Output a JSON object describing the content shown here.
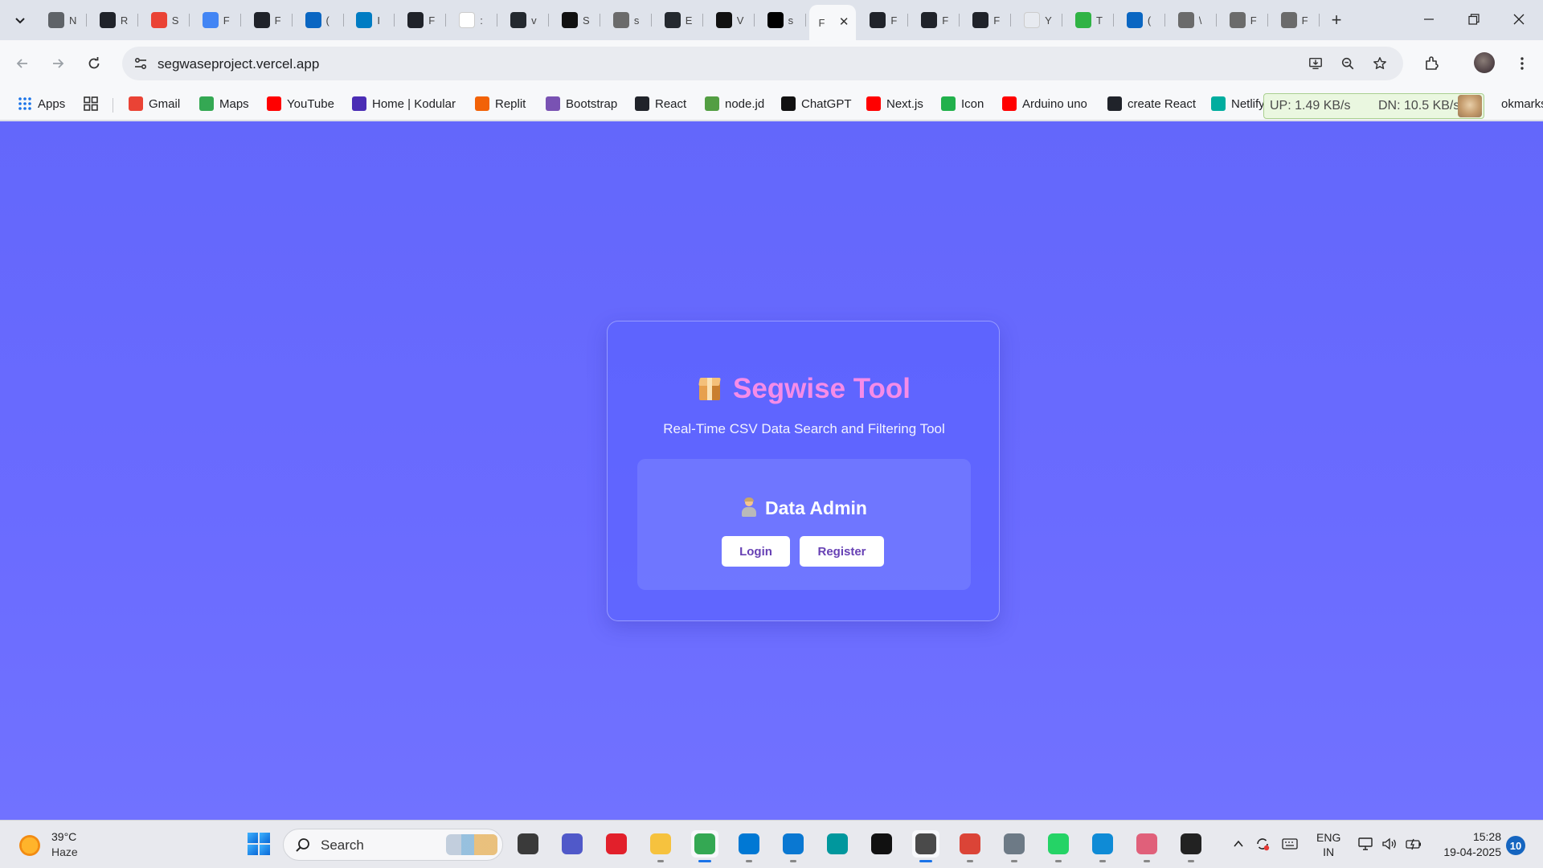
{
  "browser": {
    "tabs": [
      {
        "icon": "nf-icon",
        "letter": "N",
        "color": "#5f6368"
      },
      {
        "icon": "react-icon",
        "letter": "R",
        "color": "#20232a"
      },
      {
        "icon": "gmail-icon",
        "letter": "S",
        "color": "#ea4335"
      },
      {
        "icon": "docs-icon",
        "letter": "F",
        "color": "#4285f4"
      },
      {
        "icon": "react-icon",
        "letter": "F",
        "color": "#20232a"
      },
      {
        "icon": "linkedin-icon",
        "letter": "(",
        "color": "#0a66c2"
      },
      {
        "icon": "infosys-icon",
        "letter": "I",
        "color": "#007cc3"
      },
      {
        "icon": "react-icon",
        "letter": "F",
        "color": "#20232a"
      },
      {
        "icon": "google-icon",
        "letter": ":",
        "color": "#ffffff"
      },
      {
        "icon": "github-icon",
        "letter": "v",
        "color": "#24292f"
      },
      {
        "icon": "toolbox-icon",
        "letter": "S",
        "color": "#111111"
      },
      {
        "icon": "globe-icon",
        "letter": "s",
        "color": "#6b6b6b"
      },
      {
        "icon": "github-icon",
        "letter": "E",
        "color": "#24292f"
      },
      {
        "icon": "openai-icon",
        "letter": "V",
        "color": "#111111"
      },
      {
        "icon": "vercel-icon",
        "letter": "s",
        "color": "#000000"
      },
      {
        "icon": "page-icon",
        "letter": "F",
        "color": "#ffffff"
      },
      {
        "icon": "react-icon",
        "letter": "F",
        "color": "#20232a"
      },
      {
        "icon": "react-icon",
        "letter": "F",
        "color": "#20232a"
      },
      {
        "icon": "react-icon",
        "letter": "F",
        "color": "#20232a"
      },
      {
        "icon": "blob-icon",
        "letter": "Y",
        "color": "#e7eaf0"
      },
      {
        "icon": "s-icon",
        "letter": "T",
        "color": "#2fb344"
      },
      {
        "icon": "linkedin-icon",
        "letter": "(",
        "color": "#0a66c2"
      },
      {
        "icon": "globe-icon",
        "letter": "\\",
        "color": "#6b6b6b"
      },
      {
        "icon": "globe-icon",
        "letter": "F",
        "color": "#6b6b6b"
      },
      {
        "icon": "globe-icon",
        "letter": "F",
        "color": "#6b6b6b"
      }
    ],
    "active_tab_index": 15,
    "url": "segwaseproject.vercel.app"
  },
  "bookmarks": [
    {
      "label": "Apps",
      "icon": "apps-grid-icon",
      "color": "#1a73e8"
    },
    {
      "label": "Gmail",
      "icon": "gmail-icon",
      "color": "#ea4335"
    },
    {
      "label": "Maps",
      "icon": "maps-icon",
      "color": "#34a853"
    },
    {
      "label": "YouTube",
      "icon": "youtube-icon",
      "color": "#ff0000"
    },
    {
      "label": "Home | Kodular",
      "icon": "kodular-icon",
      "color": "#4b2db5"
    },
    {
      "label": "Replit",
      "icon": "replit-icon",
      "color": "#f26207"
    },
    {
      "label": "Bootstrap",
      "icon": "bootstrap-icon",
      "color": "#7952b3"
    },
    {
      "label": "React",
      "icon": "react-icon",
      "color": "#20232a"
    },
    {
      "label": "node.jd",
      "icon": "nodejs-icon",
      "color": "#539e43"
    },
    {
      "label": "ChatGPT",
      "icon": "openai-icon",
      "color": "#111111"
    },
    {
      "label": "Next.js",
      "icon": "youtube-icon",
      "color": "#ff0000"
    },
    {
      "label": "Icon",
      "icon": "icon-site-icon",
      "color": "#22b14c"
    },
    {
      "label": "Arduino uno",
      "icon": "youtube-icon",
      "color": "#ff0000"
    },
    {
      "label": "create React",
      "icon": "react-icon",
      "color": "#20232a"
    },
    {
      "label": "Netlify",
      "icon": "netlify-icon",
      "color": "#00ad9f"
    }
  ],
  "bookmarks_overflow_label": "okmarks",
  "netspeed": {
    "up": "UP: 1.49 KB/s",
    "dn": "DN: 10.5 KB/s"
  },
  "app": {
    "title": "Segwise Tool",
    "subtitle": "Real-Time CSV Data Search and Filtering Tool",
    "panel_title": "Data Admin",
    "login_label": "Login",
    "register_label": "Register",
    "title_color": "#f58ce8",
    "button_text_color": "#6741b4"
  },
  "taskbar": {
    "weather_temp": "39°C",
    "weather_cond": "Haze",
    "search_label": "Search",
    "lang_line1": "ENG",
    "lang_line2": "IN",
    "time": "15:28",
    "date": "19-04-2025",
    "notification_count": "10"
  }
}
